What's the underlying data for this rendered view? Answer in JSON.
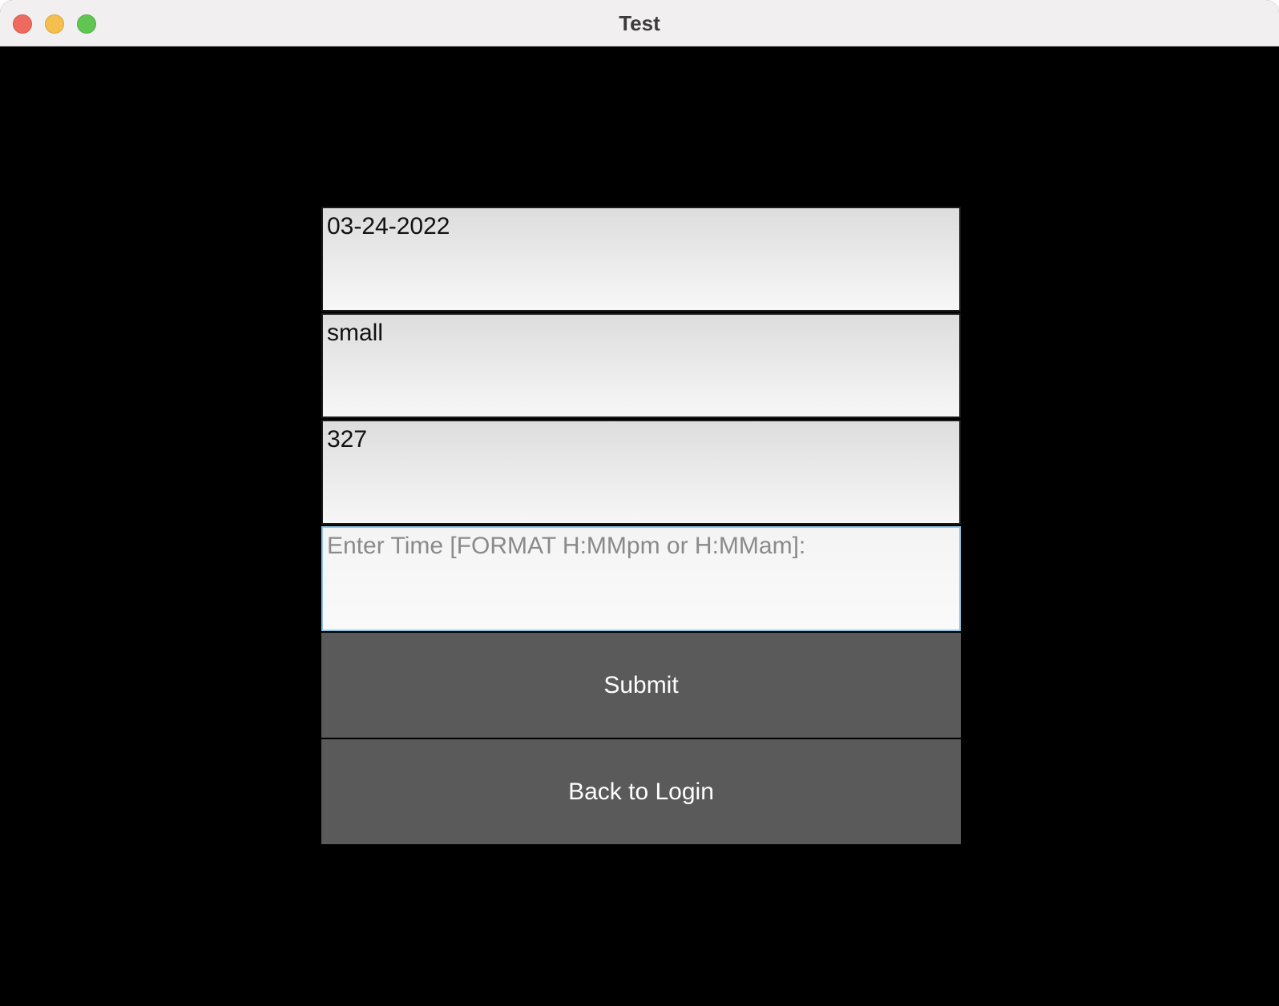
{
  "window": {
    "title": "Test"
  },
  "form": {
    "date_value": "03-24-2022",
    "size_value": "small",
    "number_value": "327",
    "time_placeholder": "Enter Time [FORMAT H:MMpm or H:MMam]:",
    "submit_label": "Submit",
    "back_label": "Back to Login"
  }
}
